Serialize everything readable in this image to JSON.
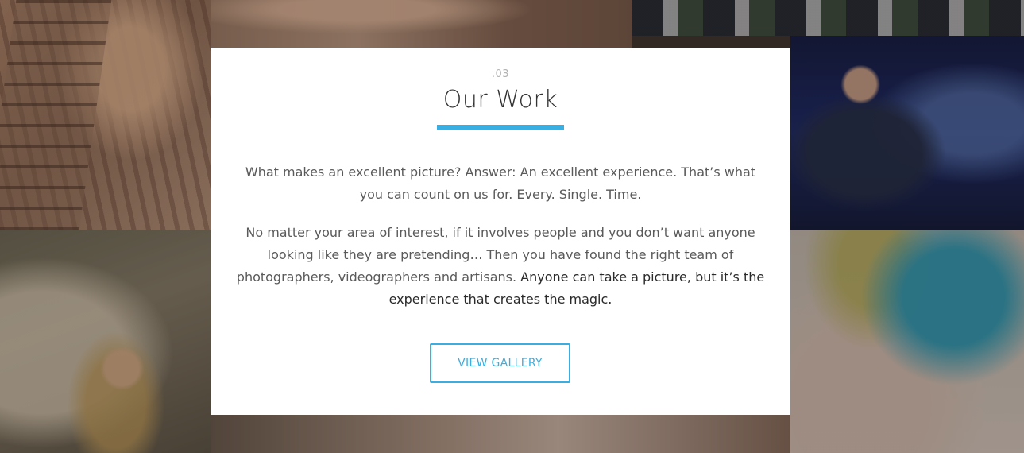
{
  "section": {
    "number": ".03",
    "title": "Our Work",
    "accent_color": "#3aaee0",
    "paragraph_1": "What makes an excellent picture? Answer: An excellent experience. That’s what you can count on us for. Every. Single. Time.",
    "paragraph_2_part_1": "No matter your area of interest, if it involves people and you don’t want anyone looking like they are pretending… Then you have found the right team of photographers, videographers and artisans.",
    "paragraph_2_part_2": "Anyone can take a picture, but it’s the experience that creates the magic.",
    "button_label": "VIEW GALLERY"
  }
}
